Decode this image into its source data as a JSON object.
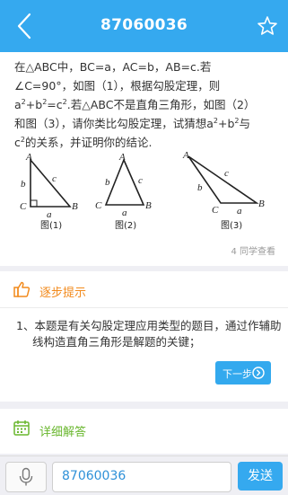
{
  "header": {
    "title": "87060036",
    "back_icon": "back-arrow-icon",
    "favorite_icon": "star-icon"
  },
  "question": {
    "line1": "在△ABC中，BC=a，AC=b，AB=c.若",
    "line2": "∠C=90°，如图（1），根据勾股定理，则",
    "line3_pre": "a",
    "line3_mid1": "+b",
    "line3_mid2": "=c",
    "line3_post": ".若△ABC不是直角三角形，如图（2）",
    "line4_pre": "和图（3），请你类比勾股定理，试猜想a",
    "line4_mid": "+b",
    "line4_post": "与",
    "line5_pre": "c",
    "line5_post": "的关系，并证明你的结论.",
    "exp": "2",
    "viewers": "4 同学查看",
    "figures": {
      "fig1": {
        "caption": "图(1)",
        "A": "A",
        "B": "B",
        "C": "C",
        "a": "a",
        "b": "b",
        "c": "c"
      },
      "fig2": {
        "caption": "图(2)",
        "A": "A",
        "B": "B",
        "C": "C",
        "a": "a",
        "b": "b",
        "c": "c"
      },
      "fig3": {
        "caption": "图(3)",
        "A": "A",
        "B": "B",
        "C": "C",
        "a": "a",
        "b": "b",
        "c": "c"
      }
    }
  },
  "hint": {
    "title": "逐步提示",
    "icon": "thumbs-up-icon",
    "body": "1、本题是有关勾股定理应用类型的题目，通过作辅助线构造直角三角形是解题的关键；",
    "next_label": "下一步"
  },
  "detail": {
    "title": "详细解答",
    "icon": "calendar-icon"
  },
  "input": {
    "value": "87060036",
    "send_label": "发送",
    "mic_icon": "microphone-icon"
  },
  "colors": {
    "primary": "#35a9ef",
    "hint_orange": "#f28a1c",
    "detail_green": "#6ab72f"
  }
}
